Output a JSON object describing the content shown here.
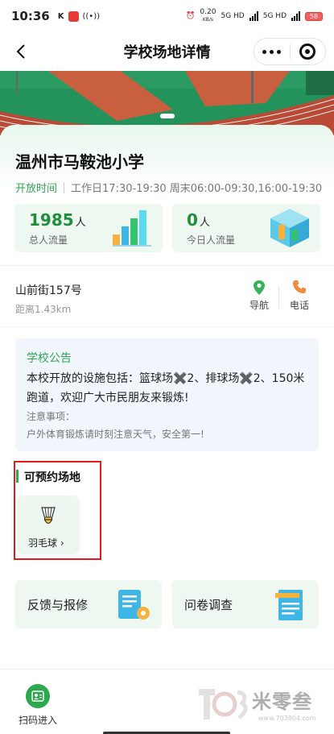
{
  "status_bar": {
    "time": "10:36",
    "k_label": "K",
    "net_speed_value": "0.20",
    "net_speed_unit": "KB/s",
    "net1": "5G HD",
    "net2": "5G HD",
    "battery": "58"
  },
  "nav": {
    "title": "学校场地详情"
  },
  "school": {
    "name": "温州市马鞍池小学",
    "hours_label": "开放时间",
    "hours_text": "工作日17:30-19:30 周末06:00-09:30,16:00-19:30"
  },
  "stats": {
    "total_value": "1985",
    "total_unit": "人",
    "total_label": "总人流量",
    "today_value": "0",
    "today_unit": "人",
    "today_label": "今日人流量"
  },
  "location": {
    "address": "山前街157号",
    "distance": "距离1.43km",
    "nav_label": "导航",
    "phone_label": "电话"
  },
  "notice": {
    "title": "学校公告",
    "body": "本校开放的设施包括：篮球场✖️2、排球场✖️2、150米跑道，欢迎广大市民朋友来锻炼!",
    "note_title": "注意事项：",
    "note_body": "户外体育锻炼请时刻注意天气，安全第一!"
  },
  "venues": {
    "title": "可预约场地",
    "items": [
      {
        "label": "羽毛球",
        "icon": "badminton-shuttlecock-icon"
      }
    ]
  },
  "tiles": {
    "feedback": "反馈与报修",
    "survey": "问卷调查"
  },
  "bottom": {
    "scan_label": "扫码进入",
    "watermark_brand": "米零叁",
    "watermark_url": "www.703804.com"
  },
  "colors": {
    "accent_green": "#2ea84f",
    "stat_green": "#1f8f3c",
    "highlight_red": "#e21b1b"
  }
}
